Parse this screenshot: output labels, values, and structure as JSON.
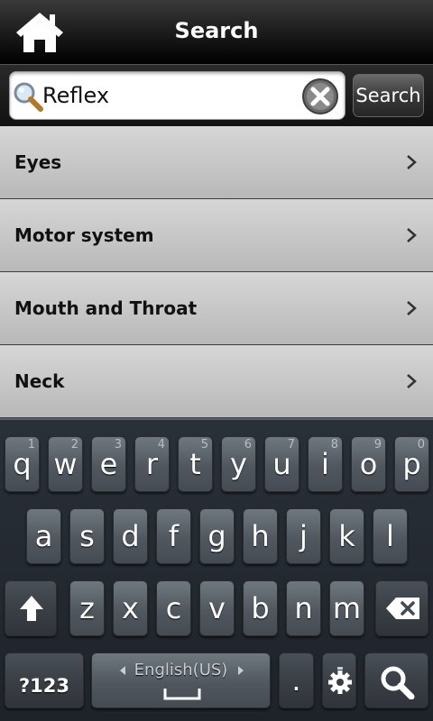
{
  "header": {
    "title": "Search",
    "home_icon": "home-icon"
  },
  "search": {
    "value": "Reflex",
    "placeholder": "",
    "button_label": "Search",
    "search_icon": "magnifier-icon",
    "clear_icon": "clear-x-icon"
  },
  "results": [
    {
      "label": "Eyes"
    },
    {
      "label": "Motor system"
    },
    {
      "label": "Mouth and Throat"
    },
    {
      "label": "Neck"
    }
  ],
  "keyboard": {
    "row1": [
      {
        "ch": "q",
        "hint": "1"
      },
      {
        "ch": "w",
        "hint": "2"
      },
      {
        "ch": "e",
        "hint": "3"
      },
      {
        "ch": "r",
        "hint": "4"
      },
      {
        "ch": "t",
        "hint": "5"
      },
      {
        "ch": "y",
        "hint": "6"
      },
      {
        "ch": "u",
        "hint": "7"
      },
      {
        "ch": "i",
        "hint": "8"
      },
      {
        "ch": "o",
        "hint": "9"
      },
      {
        "ch": "p",
        "hint": "0"
      }
    ],
    "row2": [
      "a",
      "s",
      "d",
      "f",
      "g",
      "h",
      "j",
      "k",
      "l"
    ],
    "row3": [
      "z",
      "x",
      "c",
      "v",
      "b",
      "n",
      "m"
    ],
    "symbols_label": "?123",
    "language_label": "English(US)",
    "period_label": ".",
    "icons": {
      "shift": "shift-arrow-icon",
      "backspace": "backspace-icon",
      "settings": "gear-icon",
      "search": "search-icon",
      "space": "space-bar-icon"
    }
  },
  "colors": {
    "list_bg": "#c6c6c6",
    "key_bg": "#50575f",
    "keyboard_bg": "#23282f"
  }
}
